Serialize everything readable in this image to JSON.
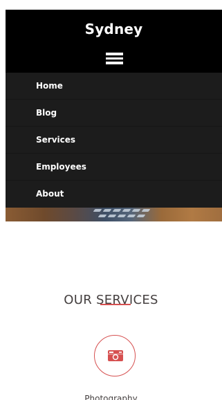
{
  "site": {
    "title": "Sydney"
  },
  "menu_toggle_icon": "hamburger-menu-icon",
  "mobile_menu": {
    "items": [
      {
        "label": "Home"
      },
      {
        "label": "Blog"
      },
      {
        "label": "Services"
      },
      {
        "label": "Employees"
      },
      {
        "label": "About"
      }
    ]
  },
  "services": {
    "heading": "OUR SERVICES",
    "items": [
      {
        "icon": "camera-retro-icon",
        "name": "Photography"
      }
    ]
  },
  "colors": {
    "header_bg": "#000000",
    "menu_bg": "#1c1c1c",
    "accent": "#d65050",
    "heading_text": "#443f3f"
  }
}
